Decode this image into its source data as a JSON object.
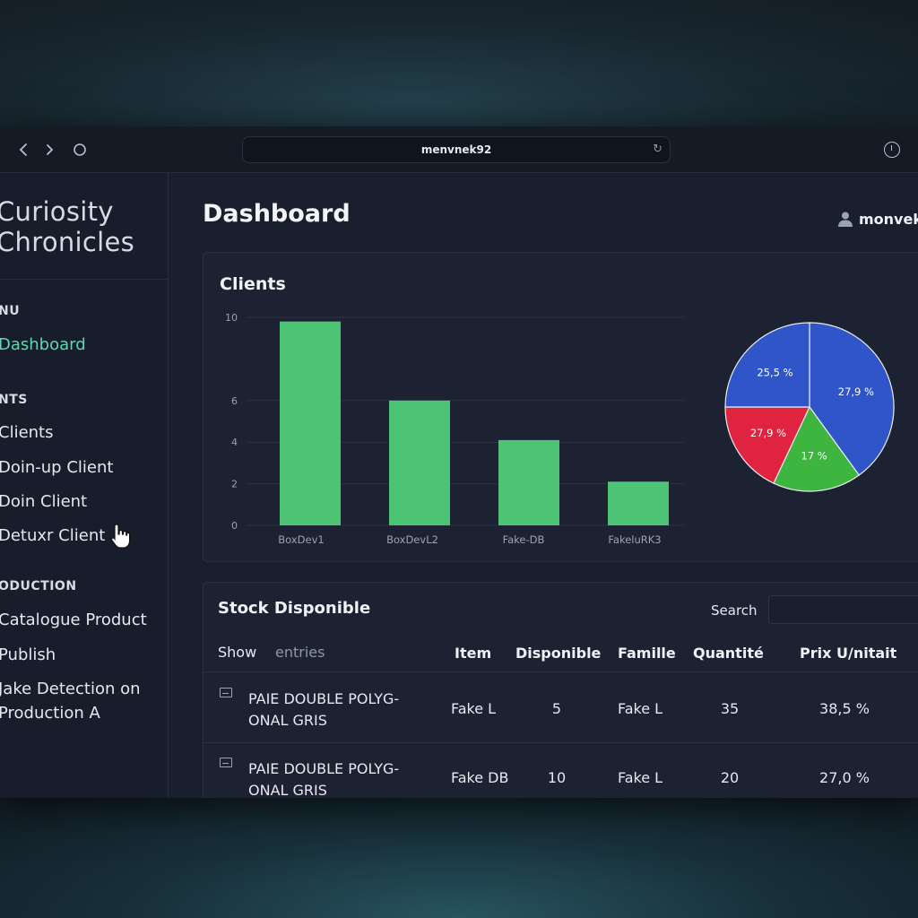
{
  "browser": {
    "url": "menvnek92",
    "back_icon": "chevron-left-icon",
    "forward_icon": "chevron-right-icon",
    "reload_icon": "reload-icon",
    "history_icon": "clock-icon"
  },
  "sidebar": {
    "brand_line1": "Curiosity",
    "brand_line2": "Chronicles",
    "sections": [
      {
        "label": "NU",
        "items": [
          {
            "label": "Dashboard",
            "active": true
          }
        ]
      },
      {
        "label": "NTS",
        "items": [
          {
            "label": "Clients"
          },
          {
            "label": "Doin-up Client"
          },
          {
            "label": "Doin Client"
          },
          {
            "label": "Detuxr Client"
          }
        ]
      },
      {
        "label": "ODUCTION",
        "items": [
          {
            "label": "Catalogue Product"
          },
          {
            "label": "Publish"
          },
          {
            "label": "Jake Detection on Production A"
          }
        ]
      }
    ]
  },
  "header": {
    "title": "Dashboard",
    "user": "monvek"
  },
  "clients": {
    "title": "Clients"
  },
  "chart_data": [
    {
      "type": "bar",
      "categories": [
        "BoxDev1",
        "BoxDevL2",
        "Fake-DB",
        "FakeluRK3"
      ],
      "values": [
        9.8,
        6.0,
        4.1,
        2.1
      ],
      "yticks": [
        0,
        2,
        4,
        6,
        10
      ],
      "ylim": [
        0,
        10
      ],
      "color": "#4dc473",
      "grid": true
    },
    {
      "type": "pie",
      "slices": [
        {
          "label": "27,9 %",
          "value": 40,
          "color": "#2f55c9"
        },
        {
          "label": "17 %",
          "value": 17,
          "color": "#3db53f"
        },
        {
          "label": "27,9 %",
          "value": 18,
          "color": "#e0243f"
        },
        {
          "label": "25,5 %",
          "value": 25,
          "color": "#2f55c9"
        }
      ]
    }
  ],
  "stock": {
    "title": "Stock Disponible",
    "search_label": "Search",
    "search_value": "",
    "show_label": "Show",
    "entries_label": "entries",
    "columns": [
      "Item",
      "Disponible",
      "Famille",
      "Quantité",
      "Prix U/nitait"
    ],
    "rows": [
      {
        "product": "PAIE DOUBLE POLYG-ONAL GRIS",
        "item": "Fake L",
        "disponible": "5",
        "famille": "Fake L",
        "quantite": "35",
        "prix": "38,5 %"
      },
      {
        "product": "PAIE DOUBLE POLYG-ONAL GRIS",
        "item": "Fake DB",
        "disponible": "10",
        "famille": "Fake L",
        "quantite": "20",
        "prix": "27,0 %"
      }
    ]
  }
}
